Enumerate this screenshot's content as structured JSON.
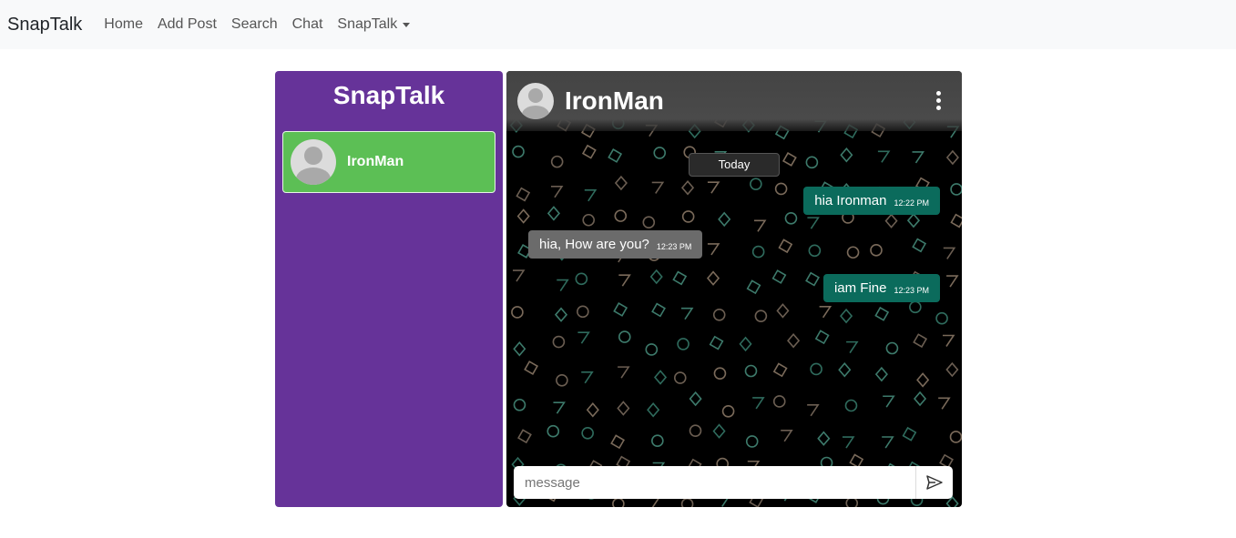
{
  "navbar": {
    "brand": "SnapTalk",
    "links": [
      "Home",
      "Add Post",
      "Search",
      "Chat"
    ],
    "dropdown_label": "SnapTalk"
  },
  "sidebar": {
    "title": "SnapTalk",
    "contacts": [
      {
        "name": "IronMan"
      }
    ]
  },
  "chat": {
    "header_name": "IronMan",
    "date_separator": "Today",
    "messages": [
      {
        "text": "hia Ironman",
        "time": "12:22 PM",
        "direction": "outgoing"
      },
      {
        "text": "hia, How are you?",
        "time": "12:23 PM",
        "direction": "incoming"
      },
      {
        "text": "iam Fine",
        "time": "12:23 PM",
        "direction": "outgoing"
      }
    ],
    "composer": {
      "placeholder": "message"
    }
  },
  "colors": {
    "sidebar_bg": "#663399",
    "active_contact_bg": "#5cbf55",
    "outgoing_bubble": "#0b6b5c",
    "incoming_bubble": "#6b6b6b"
  },
  "icons": [
    "avatar-icon",
    "kebab-menu-icon",
    "send-icon",
    "caret-down-icon"
  ]
}
